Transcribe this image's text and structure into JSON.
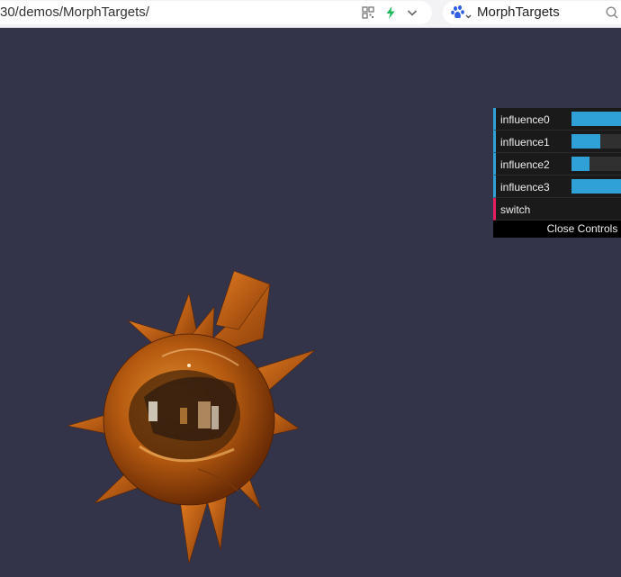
{
  "browser": {
    "url": "30/demos/MorphTargets/",
    "search_text": "MorphTargets"
  },
  "gui": {
    "controls": [
      {
        "label": "influence0",
        "value": 1.0
      },
      {
        "label": "influence1",
        "value": 0.4
      },
      {
        "label": "influence2",
        "value": 0.25
      },
      {
        "label": "influence3",
        "value": 1.0
      }
    ],
    "switch_label": "switch",
    "close_label": "Close Controls"
  },
  "colors": {
    "background": "#33334a",
    "slider_accent": "#2fa1d6",
    "function_accent": "#e61d5f",
    "mesh_orange": "#b85a10"
  }
}
